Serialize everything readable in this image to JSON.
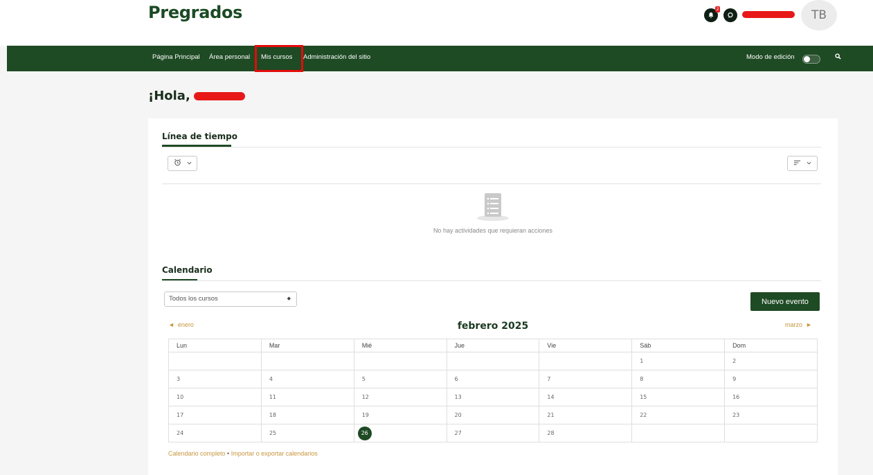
{
  "header": {
    "site_title": "Pregrados",
    "notifications_count": "2",
    "avatar_initials": "TB"
  },
  "nav": {
    "items": [
      {
        "label": "Página Principal"
      },
      {
        "label": "Área personal"
      },
      {
        "label": "Mis cursos"
      },
      {
        "label": "Administración del sitio"
      }
    ],
    "edit_mode_label": "Modo de edición"
  },
  "greeting": "¡Hola, ",
  "timeline": {
    "title": "Línea de tiempo",
    "empty_message": "No hay actividades que requieran acciones"
  },
  "calendar": {
    "title": "Calendario",
    "course_filter": "Todos los cursos",
    "new_event_label": "Nuevo evento",
    "prev_month": "enero",
    "next_month": "marzo",
    "month_title": "febrero 2025",
    "weekdays": [
      "Lun",
      "Mar",
      "Mié",
      "Jue",
      "Vie",
      "Sáb",
      "Dom"
    ],
    "weeks": [
      [
        "",
        "",
        "",
        "",
        "",
        "1",
        "2"
      ],
      [
        "3",
        "4",
        "5",
        "6",
        "7",
        "8",
        "9"
      ],
      [
        "10",
        "11",
        "12",
        "13",
        "14",
        "15",
        "16"
      ],
      [
        "17",
        "18",
        "19",
        "20",
        "21",
        "22",
        "23"
      ],
      [
        "24",
        "25",
        "26",
        "27",
        "28",
        "",
        ""
      ]
    ],
    "today": "26",
    "footer_full": "Calendario completo",
    "footer_sep": " • ",
    "footer_import": "Importar o exportar calendarios"
  },
  "colors": {
    "brand_green": "#1e4a24",
    "accent_gold": "#c8963c",
    "highlight_red": "#e50b0b"
  }
}
